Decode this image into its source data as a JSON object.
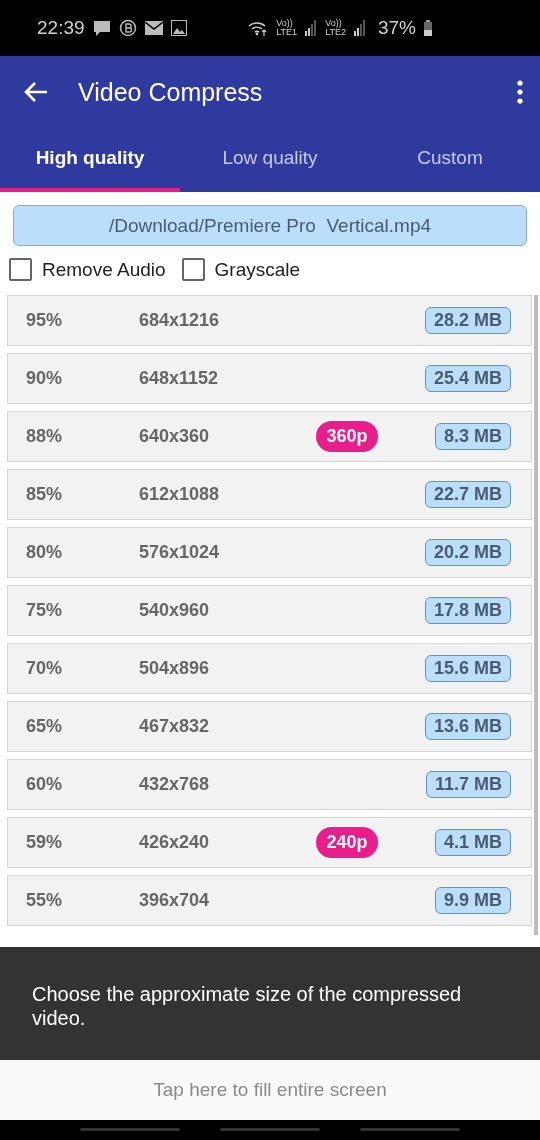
{
  "status_bar": {
    "time": "22:39",
    "sim1": {
      "top": "Vo))",
      "bottom": "LTE1"
    },
    "sim2": {
      "top": "Vo))",
      "bottom": "LTE2"
    },
    "battery": "37%"
  },
  "app_bar": {
    "title": "Video Compress"
  },
  "tabs": [
    {
      "label": "High quality",
      "selected": true
    },
    {
      "label": "Low quality",
      "selected": false
    },
    {
      "label": "Custom",
      "selected": false
    }
  ],
  "file_path": "/Download/Premiere Pro  Vertical.mp4",
  "options": [
    {
      "label": "Remove Audio",
      "checked": false
    },
    {
      "label": "Grayscale",
      "checked": false
    }
  ],
  "presets": [
    {
      "percent": "95%",
      "resolution": "684x1216",
      "size": "28.2 MB"
    },
    {
      "percent": "90%",
      "resolution": "648x1152",
      "size": "25.4 MB"
    },
    {
      "percent": "88%",
      "resolution": "640x360",
      "badge": "360p",
      "size": "8.3 MB"
    },
    {
      "percent": "85%",
      "resolution": "612x1088",
      "size": "22.7 MB"
    },
    {
      "percent": "80%",
      "resolution": "576x1024",
      "size": "20.2 MB"
    },
    {
      "percent": "75%",
      "resolution": "540x960",
      "size": "17.8 MB"
    },
    {
      "percent": "70%",
      "resolution": "504x896",
      "size": "15.6 MB"
    },
    {
      "percent": "65%",
      "resolution": "467x832",
      "size": "13.6 MB"
    },
    {
      "percent": "60%",
      "resolution": "432x768",
      "size": "11.7 MB"
    },
    {
      "percent": "59%",
      "resolution": "426x240",
      "badge": "240p",
      "size": "4.1 MB"
    },
    {
      "percent": "55%",
      "resolution": "396x704",
      "size": "9.9 MB"
    }
  ],
  "hint": "Choose the approximate size of the compressed video.",
  "fill_screen": "Tap here to fill entire screen"
}
